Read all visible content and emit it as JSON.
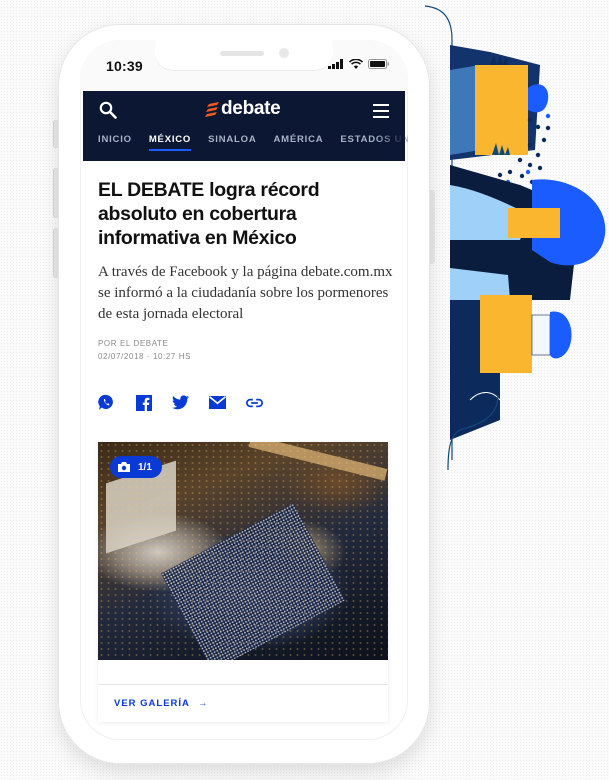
{
  "status_bar": {
    "time": "10:39"
  },
  "header": {
    "logo_text": "debate",
    "nav": [
      {
        "label": "INICIO",
        "active": false
      },
      {
        "label": "MÉXICO",
        "active": true
      },
      {
        "label": "SINALOA",
        "active": false
      },
      {
        "label": "AMÉRICA",
        "active": false
      },
      {
        "label": "ESTADOS UNID",
        "active": false
      }
    ]
  },
  "article": {
    "headline": "EL DEBATE logra récord absoluto en cobertura informativa en México",
    "summary": "A través de Facebook y la página debate.com.mx se informó a la ciudadanía sobre los pormenores de esta jornada electoral",
    "author": "POR EL DEBATE",
    "date": "02/07/2018 · 10:27 HS",
    "share_icons": [
      "whatsapp-icon",
      "facebook-icon",
      "twitter-icon",
      "email-icon",
      "link-icon"
    ]
  },
  "gallery": {
    "counter": "1/1",
    "link_label": "VER GALERÍA",
    "link_arrow": "→"
  },
  "colors": {
    "header_bg": "#0c1733",
    "accent_blue": "#0a3ad6",
    "active_underline": "#1a5cff",
    "logo_orange": "#f25c1f",
    "illustration_yellow": "#fbb630",
    "illustration_navy": "#0c2a5c"
  }
}
